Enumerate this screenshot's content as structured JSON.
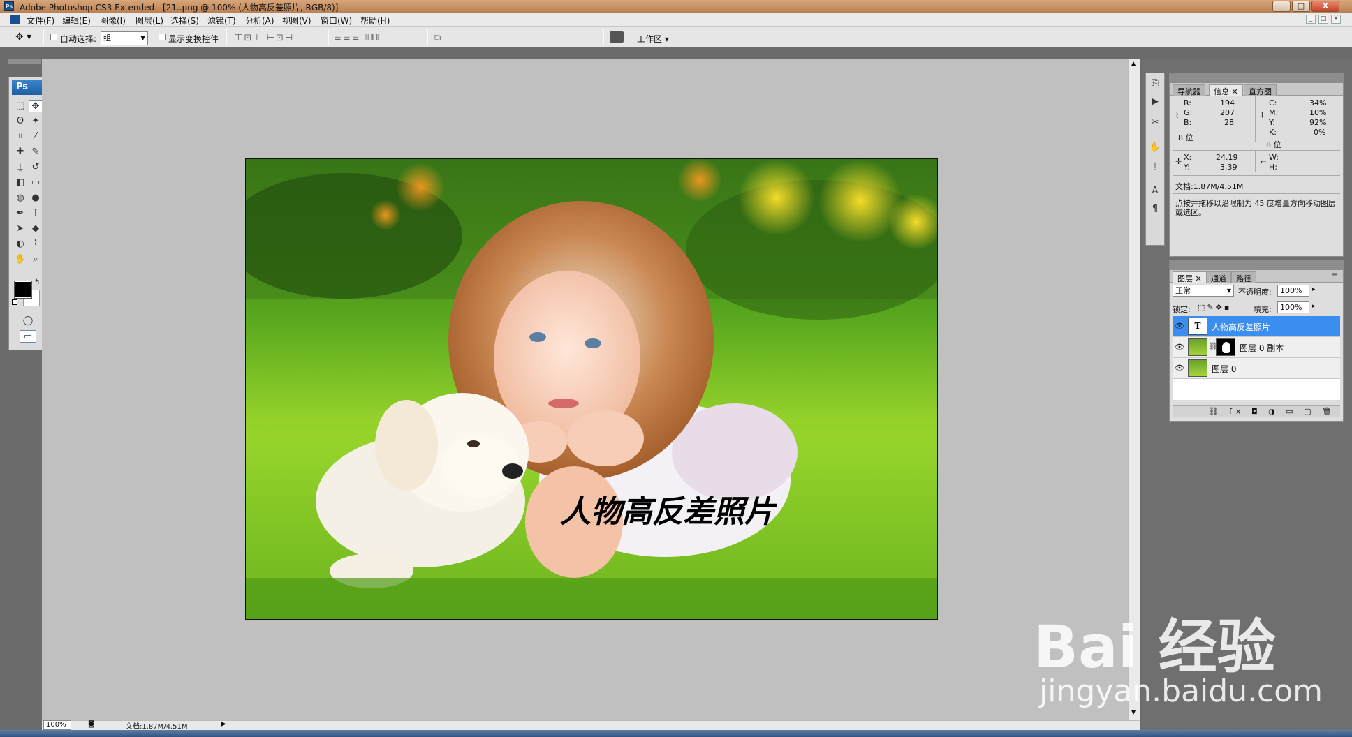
{
  "window": {
    "title": "Adobe Photoshop CS3 Extended - [21..png @ 100% (人物高反差照片, RGB/8)]",
    "logo_text": "Ps",
    "min_label": "_",
    "max_label": "□",
    "close_label": "X"
  },
  "menu": {
    "items": [
      "文件(F)",
      "编辑(E)",
      "图像(I)",
      "图层(L)",
      "选择(S)",
      "滤镜(T)",
      "分析(A)",
      "视图(V)",
      "窗口(W)",
      "帮助(H)"
    ]
  },
  "options_bar": {
    "auto_select_label": "自动选择:",
    "auto_select_value": "组",
    "show_transform_label": "显示变换控件",
    "workspace_label": "工作区 ▾",
    "align_icons": "⊤⊡⊥ ⊢⊡⊣",
    "distribute_icons": "≡≡≡ ⦀⦀⦀",
    "auto_align_icon": "⧉"
  },
  "toolbox": {
    "badge": "Ps",
    "tools": [
      {
        "name": "marquee-tool",
        "glyph": "⬚"
      },
      {
        "name": "move-tool",
        "glyph": "✥"
      },
      {
        "name": "lasso-tool",
        "glyph": "ʘ"
      },
      {
        "name": "magic-wand-tool",
        "glyph": "✦"
      },
      {
        "name": "crop-tool",
        "glyph": "⌗"
      },
      {
        "name": "slice-tool",
        "glyph": "⁄"
      },
      {
        "name": "healing-brush-tool",
        "glyph": "✚"
      },
      {
        "name": "brush-tool",
        "glyph": "✎"
      },
      {
        "name": "clone-stamp-tool",
        "glyph": "⍊"
      },
      {
        "name": "history-brush-tool",
        "glyph": "↺"
      },
      {
        "name": "eraser-tool",
        "glyph": "◧"
      },
      {
        "name": "gradient-tool",
        "glyph": "▭"
      },
      {
        "name": "blur-tool",
        "glyph": "◍"
      },
      {
        "name": "dodge-tool",
        "glyph": "●"
      },
      {
        "name": "pen-tool",
        "glyph": "✒"
      },
      {
        "name": "type-tool",
        "glyph": "T"
      },
      {
        "name": "path-selection-tool",
        "glyph": "➤"
      },
      {
        "name": "shape-tool",
        "glyph": "◆"
      },
      {
        "name": "3d-rotate-tool",
        "glyph": "◐"
      },
      {
        "name": "eyedropper-tool",
        "glyph": "⌇"
      },
      {
        "name": "hand-tool",
        "glyph": "✋"
      },
      {
        "name": "zoom-tool",
        "glyph": "⌕"
      }
    ],
    "quick_mask_glyph": "◯",
    "screen_mode_glyph": "▭"
  },
  "info_panel": {
    "tabs": [
      "导航器",
      "信息",
      "直方图"
    ],
    "active_tab": "信息",
    "rgb": {
      "R": "194",
      "G": "207",
      "B": "28"
    },
    "cmyk": {
      "C": "34%",
      "M": "10%",
      "Y": "92%",
      "K": "0%"
    },
    "bits_left": "8 位",
    "bits_right": "8 位",
    "xy": {
      "X": "24.19",
      "Y": "3.39"
    },
    "wh": {
      "W": "",
      "H": ""
    },
    "doc_size": "文档:1.87M/4.51M",
    "hint": "点按并拖移以沿限制为 45 度增量方向移动图层或选区。"
  },
  "layers_panel": {
    "tabs": [
      "图层",
      "通道",
      "路径"
    ],
    "active_tab": "图层",
    "blend_mode": "正常",
    "opacity_label": "不透明度:",
    "opacity_value": "100%",
    "lock_label": "锁定:",
    "fill_label": "填充:",
    "fill_value": "100%",
    "layers": [
      {
        "name": "人物高反差照片",
        "type": "text",
        "selected": true
      },
      {
        "name": "图层 0 副本",
        "type": "masked",
        "selected": false
      },
      {
        "name": "图层 0",
        "type": "image",
        "selected": false
      }
    ],
    "footer_icons": "⛓ fx ◘ ◑ ▭ ▢ 🗑"
  },
  "canvas": {
    "image_caption": "人物高反差照片"
  },
  "statusbar": {
    "zoom": "100%",
    "doc": "文档:1.87M/4.51M"
  },
  "watermark": {
    "main": "Bai 经验",
    "sub": "jingyan.baidu.com"
  },
  "colors": {
    "accent": "#3a8ef0",
    "workspace": "#c0c0c0"
  }
}
